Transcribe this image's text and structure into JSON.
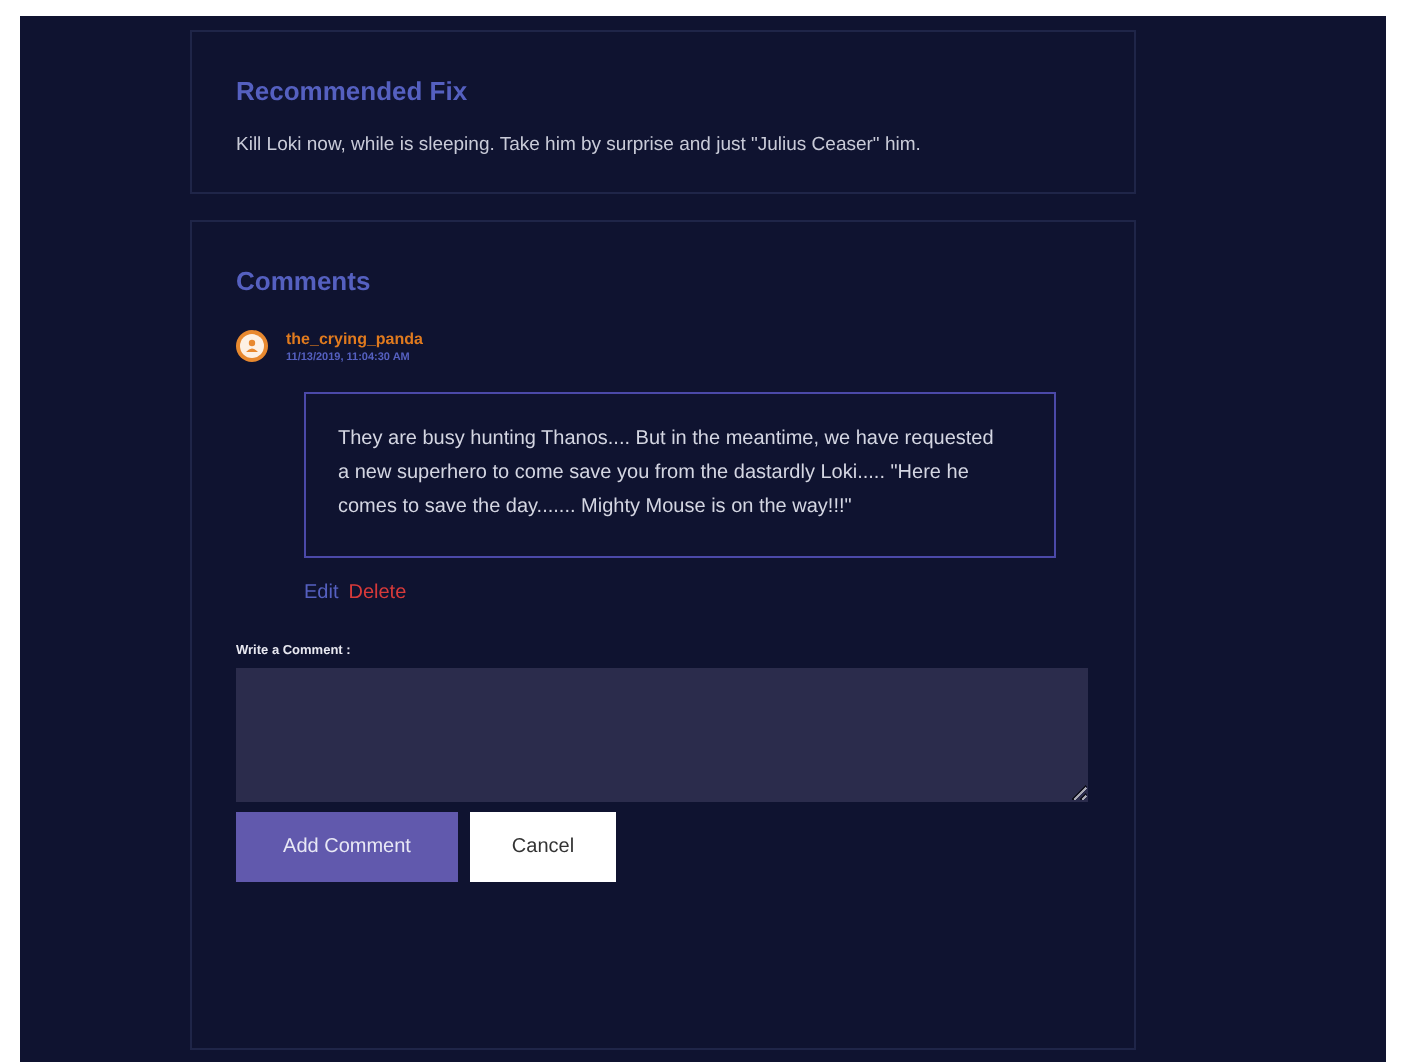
{
  "recommended_fix": {
    "title": "Recommended Fix",
    "text": "Kill Loki now, while is sleeping. Take him by surprise and just \"Julius Ceaser\" him."
  },
  "comments": {
    "title": "Comments",
    "items": [
      {
        "author": "the_crying_panda",
        "timestamp": "11/13/2019, 11:04:30 AM",
        "text": "They are busy hunting Thanos.... But in the meantime, we have requested a new superhero to come save you from the dastardly Loki..... \"Here he comes to save the day....... Mighty Mouse is on the way!!!\"",
        "actions": [
          {
            "label": "Edit",
            "kind": "edit"
          },
          {
            "label": "Delete",
            "kind": "delete"
          }
        ]
      }
    ],
    "form": {
      "label": "Write a Comment :",
      "buttons": [
        {
          "label": "Add Comment",
          "kind": "primary"
        },
        {
          "label": "Cancel",
          "kind": "secondary"
        }
      ]
    }
  }
}
